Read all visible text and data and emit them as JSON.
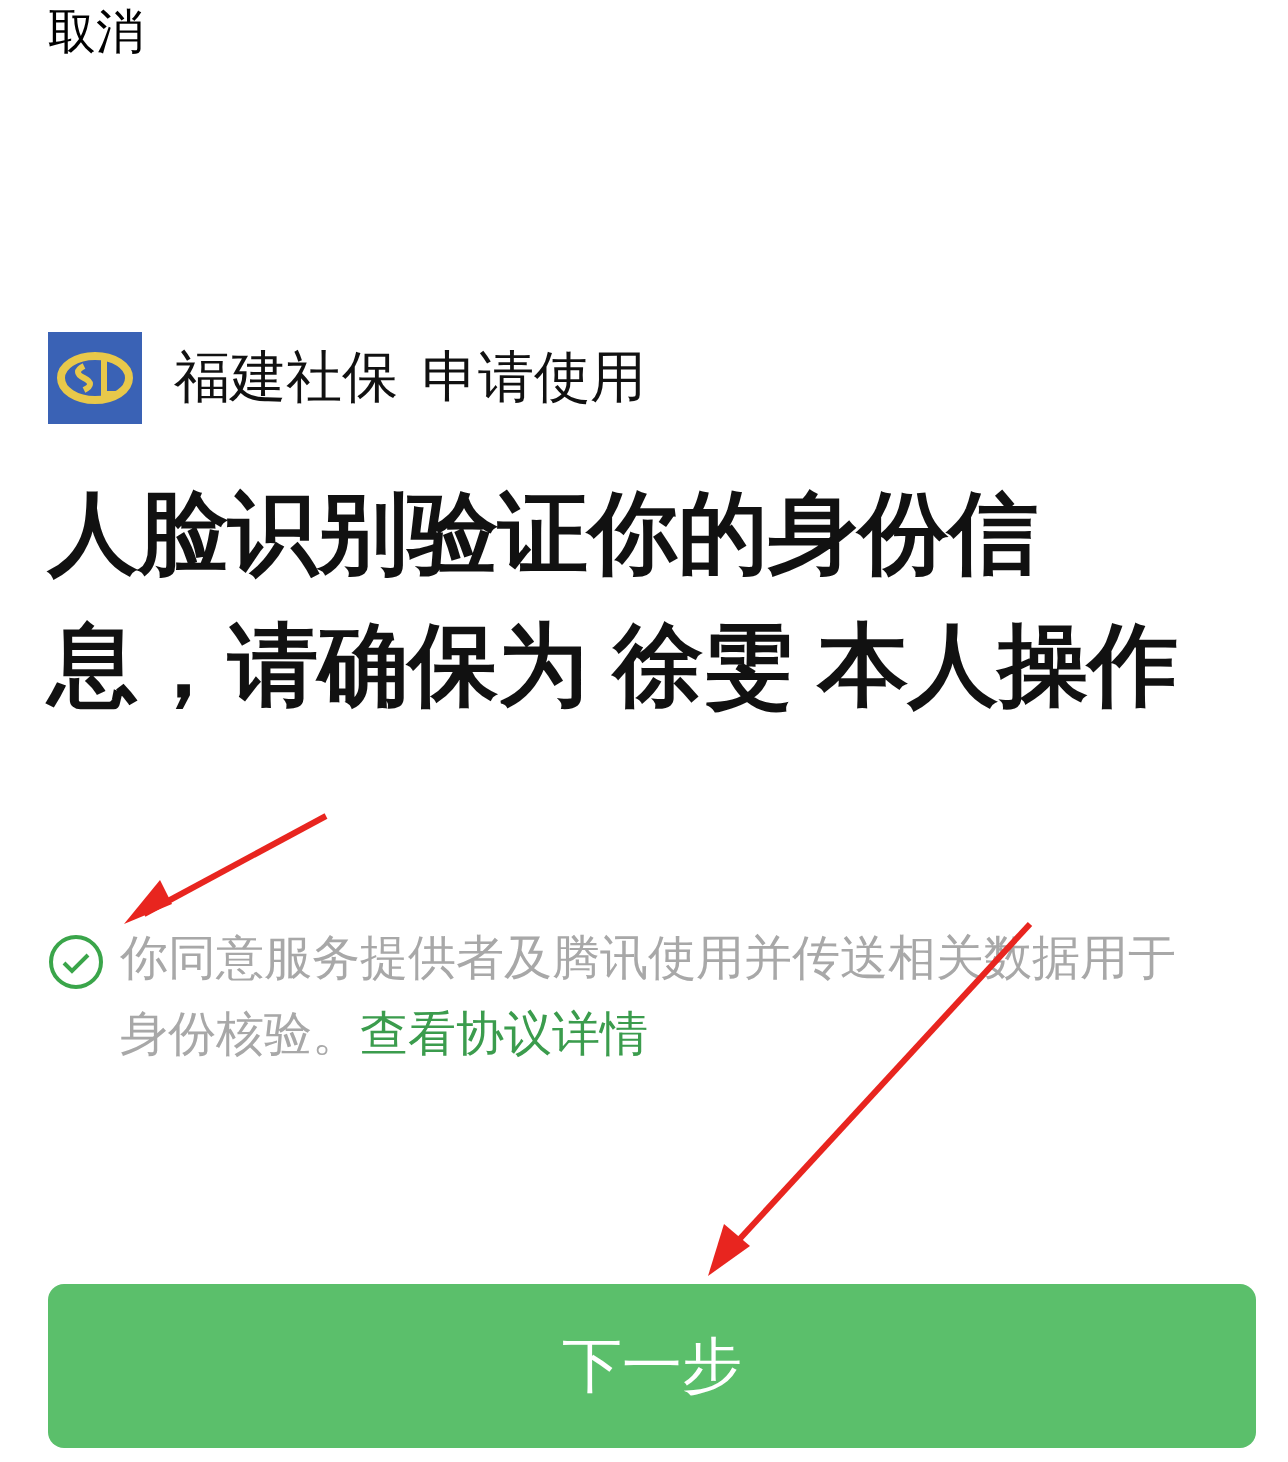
{
  "cancel": "取消",
  "app": {
    "name": "福建社保",
    "action": "申请使用"
  },
  "heading_lines": [
    "人脸识别验证你的身份信",
    "息，请确保为 徐雯 本人操作"
  ],
  "agreement": {
    "checked": true,
    "text": "你同意服务提供者及腾讯使用并传送相关数据用于身份核验。",
    "link": "查看协议详情"
  },
  "button": "下一步"
}
